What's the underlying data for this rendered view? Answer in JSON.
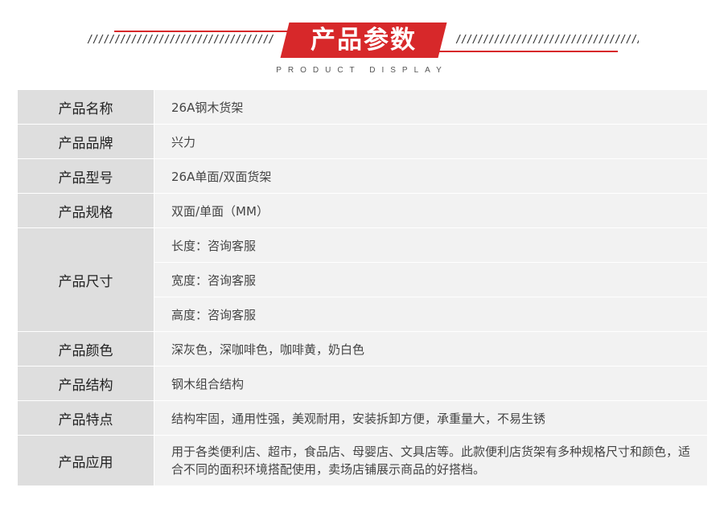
{
  "header": {
    "title": "产品参数",
    "subtitle": "PRODUCT DISPLAY",
    "slashes_left": "////////////////////////////////////////",
    "slashes_right": "////////////////////////////////////////"
  },
  "rows": [
    {
      "label": "产品名称",
      "values": [
        "26A钢木货架"
      ]
    },
    {
      "label": "产品品牌",
      "values": [
        "兴力"
      ]
    },
    {
      "label": "产品型号",
      "values": [
        "26A单面/双面货架"
      ]
    },
    {
      "label": "产品规格",
      "values": [
        "双面/单面（MM）"
      ]
    },
    {
      "label": "产品尺寸",
      "values": [
        "长度：咨询客服",
        "宽度：咨询客服",
        "高度：咨询客服"
      ]
    },
    {
      "label": "产品颜色",
      "values": [
        "深灰色，深咖啡色，咖啡黄，奶白色"
      ]
    },
    {
      "label": "产品结构",
      "values": [
        "钢木组合结构"
      ]
    },
    {
      "label": "产品特点",
      "values": [
        "结构牢固，通用性强，美观耐用，安装拆卸方便，承重量大，不易生锈"
      ]
    },
    {
      "label": "产品应用",
      "values": [
        "用于各类便利店、超市，食品店、母婴店、文具店等。此款便利店货架有多种规格尺寸和颜色，适合不同的面积环境搭配使用，卖场店铺展示商品的好搭档。"
      ]
    }
  ]
}
